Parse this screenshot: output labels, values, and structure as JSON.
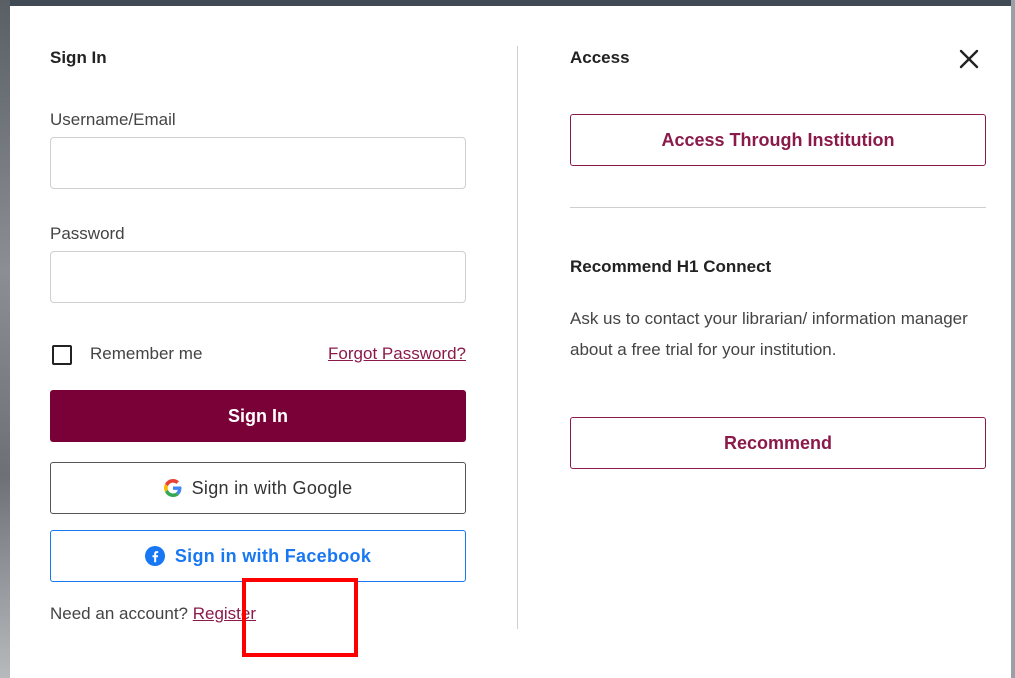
{
  "signin": {
    "title": "Sign In",
    "username_label": "Username/Email",
    "username_value": "",
    "password_label": "Password",
    "password_value": "",
    "remember_label": "Remember me",
    "remember_checked": false,
    "forgot_link": "Forgot Password?",
    "submit_label": "Sign In",
    "google_label": "Sign in with Google",
    "facebook_label": "Sign in with Facebook",
    "need_account_text": "Need an account? ",
    "register_link": "Register"
  },
  "access": {
    "title": "Access",
    "institution_button": "Access Through Institution",
    "recommend_heading": "Recommend H1 Connect",
    "recommend_text": "Ask us to contact your librarian/ information manager about a free trial for your institution.",
    "recommend_button": "Recommend"
  },
  "icons": {
    "close": "close-icon",
    "google": "google-icon",
    "facebook": "facebook-icon"
  },
  "colors": {
    "brand": "#7a0038",
    "brand_text": "#8a1a4a",
    "facebook": "#1877f2",
    "highlight": "#ff0000"
  }
}
